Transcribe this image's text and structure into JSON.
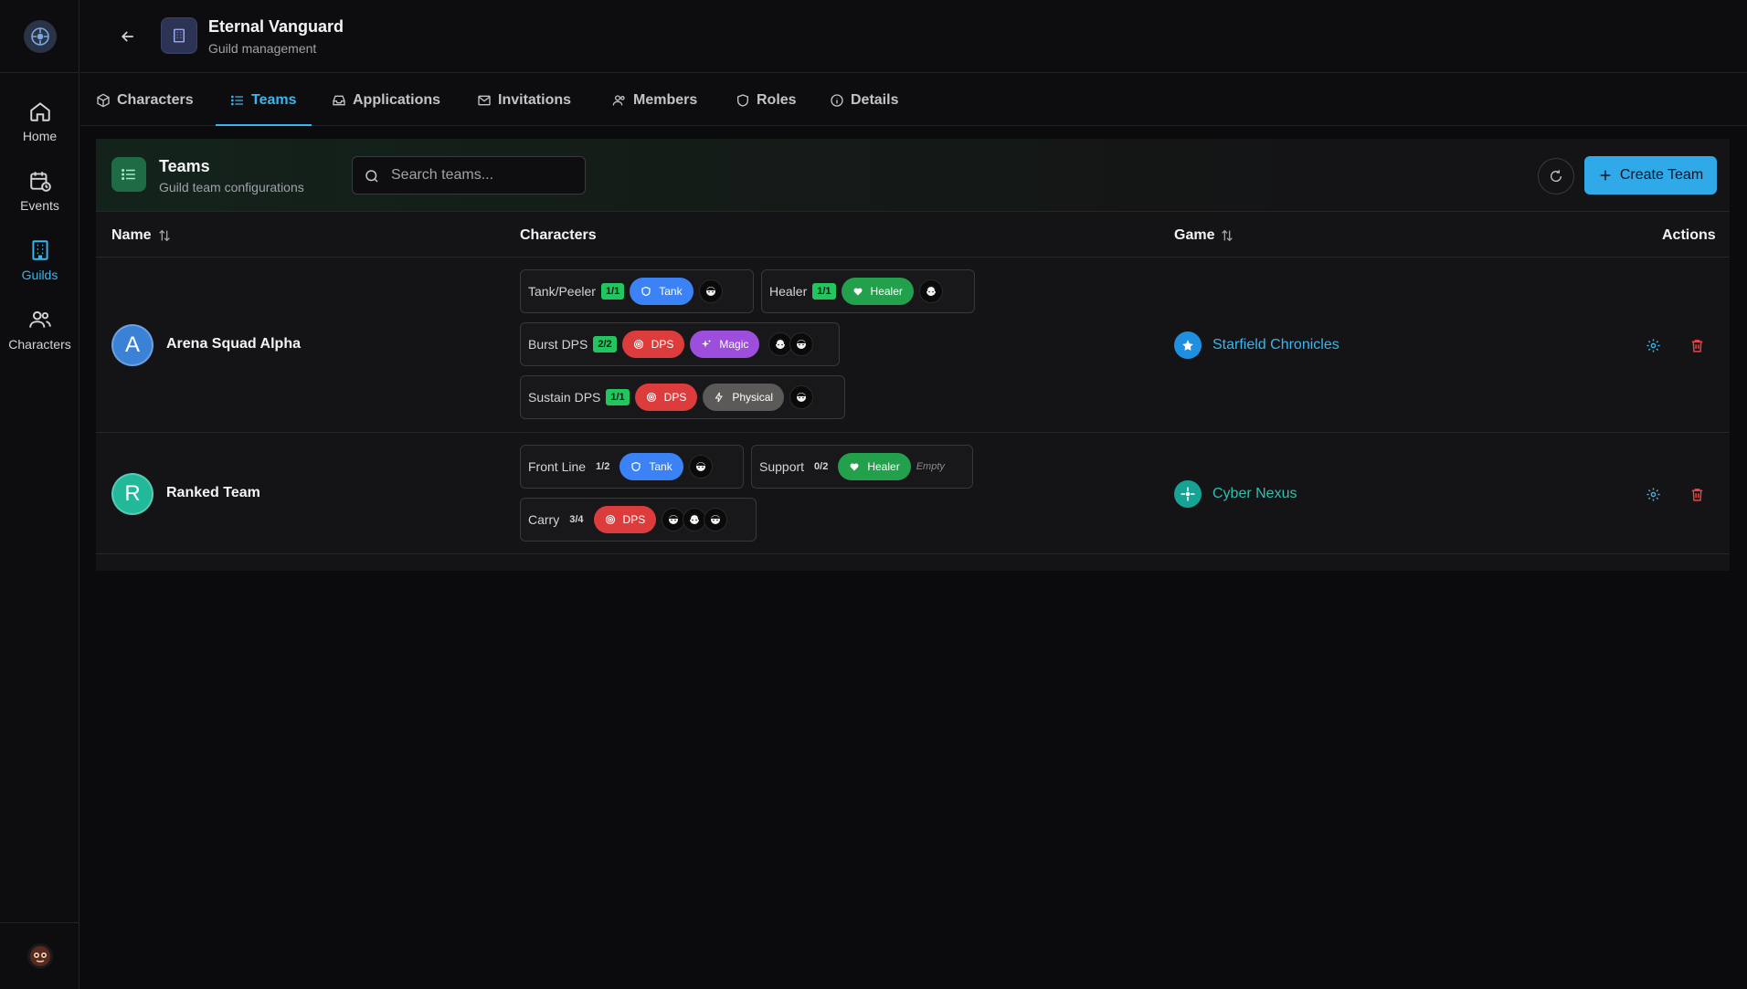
{
  "sidebar": {
    "items": [
      {
        "label": "Home"
      },
      {
        "label": "Events"
      },
      {
        "label": "Guilds"
      },
      {
        "label": "Characters"
      }
    ]
  },
  "header": {
    "title": "Eternal Vanguard",
    "subtitle": "Guild management"
  },
  "tabs": [
    {
      "label": "Characters"
    },
    {
      "label": "Teams"
    },
    {
      "label": "Applications"
    },
    {
      "label": "Invitations"
    },
    {
      "label": "Members"
    },
    {
      "label": "Roles"
    },
    {
      "label": "Details"
    }
  ],
  "panel": {
    "title": "Teams",
    "subtitle": "Guild team configurations",
    "search_placeholder": "Search teams...",
    "create_label": "Create Team"
  },
  "table": {
    "columns": {
      "name": "Name",
      "characters": "Characters",
      "game": "Game",
      "actions": "Actions"
    },
    "rows": [
      {
        "initial": "A",
        "name": "Arena Squad Alpha",
        "game": "Starfield Chronicles",
        "slots": [
          {
            "name": "Tank/Peeler",
            "count": "1/1",
            "tags": [
              "Tank"
            ]
          },
          {
            "name": "Healer",
            "count": "1/1",
            "tags": [
              "Healer"
            ]
          },
          {
            "name": "Burst DPS",
            "count": "2/2",
            "tags": [
              "DPS",
              "Magic"
            ]
          },
          {
            "name": "Sustain DPS",
            "count": "1/1",
            "tags": [
              "DPS",
              "Physical"
            ]
          }
        ]
      },
      {
        "initial": "R",
        "name": "Ranked Team",
        "game": "Cyber Nexus",
        "slots": [
          {
            "name": "Front Line",
            "count": "1/2",
            "tags": [
              "Tank"
            ]
          },
          {
            "name": "Support",
            "count": "0/2",
            "tags": [
              "Healer"
            ],
            "empty_label": "Empty"
          },
          {
            "name": "Carry",
            "count": "3/4",
            "tags": [
              "DPS"
            ]
          }
        ]
      }
    ]
  },
  "colors": {
    "accent": "#38b6f1",
    "tank": "#3b82f6",
    "healer": "#22a04b",
    "dps": "#dc3c3c",
    "magic": "#9d4edd",
    "physical": "#5c5a58",
    "full_count": "#22c55e",
    "delete": "#ef4444"
  },
  "icons": [
    "logo-icon",
    "home-icon",
    "calendar-icon",
    "building-icon",
    "users-icon",
    "arrow-left-icon",
    "cube-icon",
    "list-icon",
    "inbox-icon",
    "mail-icon",
    "shield-icon",
    "info-icon",
    "search-icon",
    "refresh-icon",
    "plus-icon",
    "sort-icon",
    "heart-icon",
    "target-icon",
    "sparkle-icon",
    "bolt-icon",
    "gear-icon",
    "trash-icon"
  ]
}
